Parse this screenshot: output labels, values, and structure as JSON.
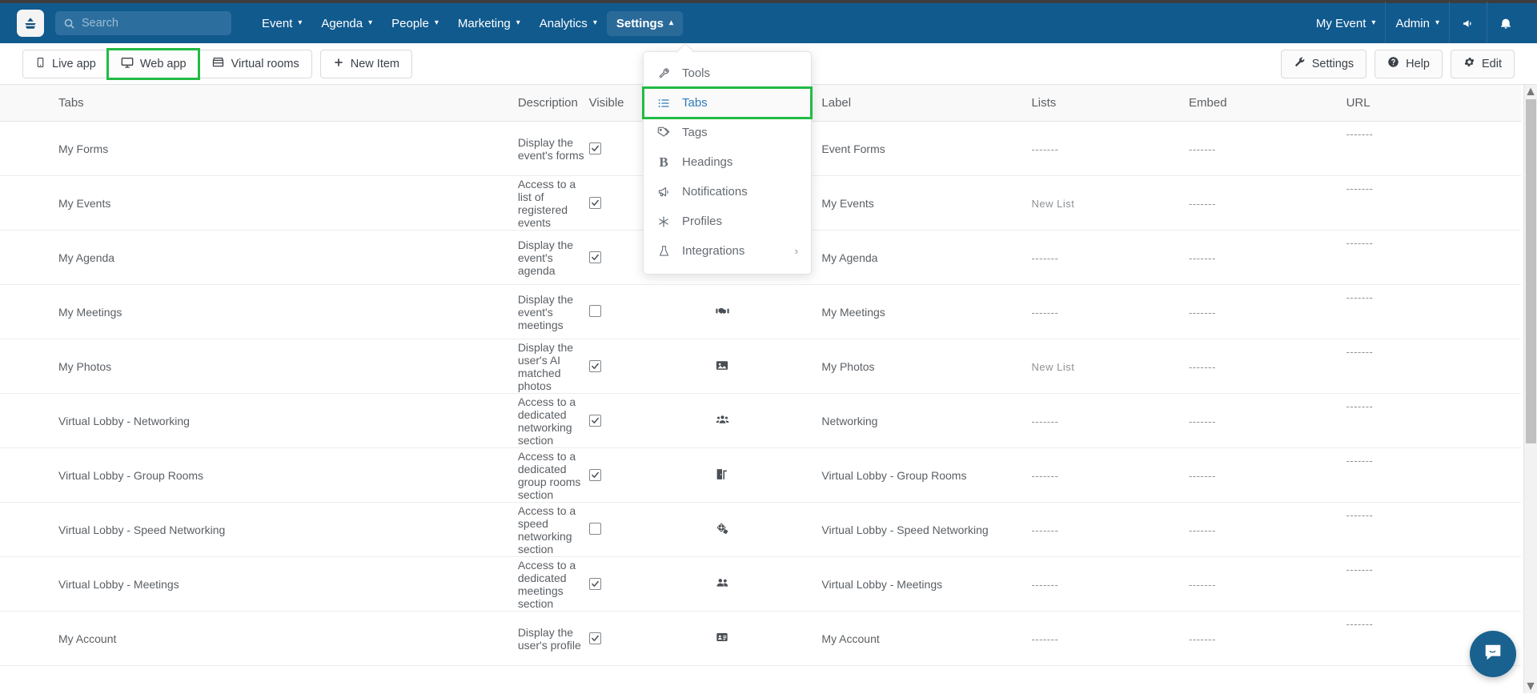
{
  "topbar": {
    "logo_icon": "app-logo-icon",
    "search": {
      "placeholder": "Search",
      "value": "",
      "icon": "search-icon"
    },
    "nav": [
      {
        "label": "Event",
        "icon": "chevron-down-icon",
        "active": false
      },
      {
        "label": "Agenda",
        "icon": "chevron-down-icon",
        "active": false
      },
      {
        "label": "People",
        "icon": "chevron-down-icon",
        "active": false
      },
      {
        "label": "Marketing",
        "icon": "chevron-down-icon",
        "active": false
      },
      {
        "label": "Analytics",
        "icon": "chevron-down-icon",
        "active": false
      },
      {
        "label": "Settings",
        "icon": "chevron-up-icon",
        "active": true
      }
    ],
    "right": [
      {
        "label": "My Event",
        "icon": "chevron-down-icon"
      },
      {
        "label": "Admin",
        "icon": "chevron-down-icon"
      }
    ],
    "right_icons": [
      {
        "name": "megaphone-icon"
      },
      {
        "name": "bell-icon"
      }
    ],
    "accent": "#115a8e"
  },
  "toolbar": {
    "left": [
      {
        "label": "Live app",
        "icon": "mobile-icon",
        "highlighted": false
      },
      {
        "label": "Web app",
        "icon": "desktop-icon",
        "highlighted": true
      },
      {
        "label": "Virtual rooms",
        "icon": "store-icon",
        "highlighted": false
      }
    ],
    "new_item": {
      "label": "New Item",
      "icon": "plus-icon"
    },
    "right": [
      {
        "label": "Settings",
        "icon": "wrench-icon"
      },
      {
        "label": "Help",
        "icon": "question-circle-icon"
      },
      {
        "label": "Edit",
        "icon": "gear-icon"
      }
    ],
    "highlight_color": "#22bb44"
  },
  "dropdown": {
    "open": true,
    "items": [
      {
        "label": "Tools",
        "icon": "wrench-icon",
        "active": false,
        "submenu": false
      },
      {
        "label": "Tabs",
        "icon": "list-ol-icon",
        "active": true,
        "submenu": false
      },
      {
        "label": "Tags",
        "icon": "tags-icon",
        "active": false,
        "submenu": false
      },
      {
        "label": "Headings",
        "icon": "bold-b-icon",
        "active": false,
        "submenu": false
      },
      {
        "label": "Notifications",
        "icon": "megaphone-icon",
        "active": false,
        "submenu": false
      },
      {
        "label": "Profiles",
        "icon": "asterisk-icon",
        "active": false,
        "submenu": false
      },
      {
        "label": "Integrations",
        "icon": "flask-icon",
        "active": false,
        "submenu": true
      }
    ],
    "submenu_icon": "chevron-right-icon"
  },
  "table": {
    "columns": [
      "Tabs",
      "Description",
      "Visible",
      "",
      "Label",
      "Lists",
      "Embed",
      "URL"
    ],
    "dash": "-------",
    "rows": [
      {
        "tab": "My Forms",
        "description": "Display the event's forms",
        "visible": true,
        "icon": "form-icon",
        "label": "Event Forms",
        "lists": "-------",
        "embed": "-------",
        "url": "-------"
      },
      {
        "tab": "My Events",
        "description": "Access to a list of registered events",
        "visible": true,
        "icon": "calendar-icon",
        "label": "My Events",
        "lists": "New List",
        "embed": "-------",
        "url": "-------"
      },
      {
        "tab": "My Agenda",
        "description": "Display the event's agenda",
        "visible": true,
        "icon": "agenda-icon",
        "label": "My Agenda",
        "lists": "-------",
        "embed": "-------",
        "url": "-------"
      },
      {
        "tab": "My Meetings",
        "description": "Display the event's meetings",
        "visible": false,
        "icon": "handshake-icon",
        "label": "My Meetings",
        "lists": "-------",
        "embed": "-------",
        "url": "-------"
      },
      {
        "tab": "My Photos",
        "description": "Display the user's AI matched photos",
        "visible": true,
        "icon": "image-icon",
        "label": "My Photos",
        "lists": "New List",
        "embed": "-------",
        "url": "-------"
      },
      {
        "tab": "Virtual Lobby - Networking",
        "description": "Access to a dedicated networking section",
        "visible": true,
        "icon": "users-group-icon",
        "label": "Networking",
        "lists": "-------",
        "embed": "-------",
        "url": "-------"
      },
      {
        "tab": "Virtual Lobby - Group Rooms",
        "description": "Access to a dedicated group rooms section",
        "visible": true,
        "icon": "door-open-icon",
        "label": "Virtual Lobby - Group Rooms",
        "lists": "-------",
        "embed": "-------",
        "url": "-------"
      },
      {
        "tab": "Virtual Lobby - Speed Networking",
        "description": "Access to a speed networking section",
        "visible": false,
        "icon": "speed-networking-icon",
        "label": "Virtual Lobby - Speed Networking",
        "lists": "-------",
        "embed": "-------",
        "url": "-------"
      },
      {
        "tab": "Virtual Lobby - Meetings",
        "description": "Access to a dedicated meetings section",
        "visible": true,
        "icon": "user-friends-icon",
        "label": "Virtual Lobby - Meetings",
        "lists": "-------",
        "embed": "-------",
        "url": "-------"
      },
      {
        "tab": "My Account",
        "description": "Display the user's profile",
        "visible": true,
        "icon": "id-card-icon",
        "label": "My Account",
        "lists": "-------",
        "embed": "-------",
        "url": "-------"
      }
    ]
  },
  "scrollbar": {
    "up_icon": "caret-up-icon",
    "down_icon": "caret-down-icon"
  },
  "chat": {
    "icon": "chat-bubble-icon",
    "color": "#19628f"
  }
}
